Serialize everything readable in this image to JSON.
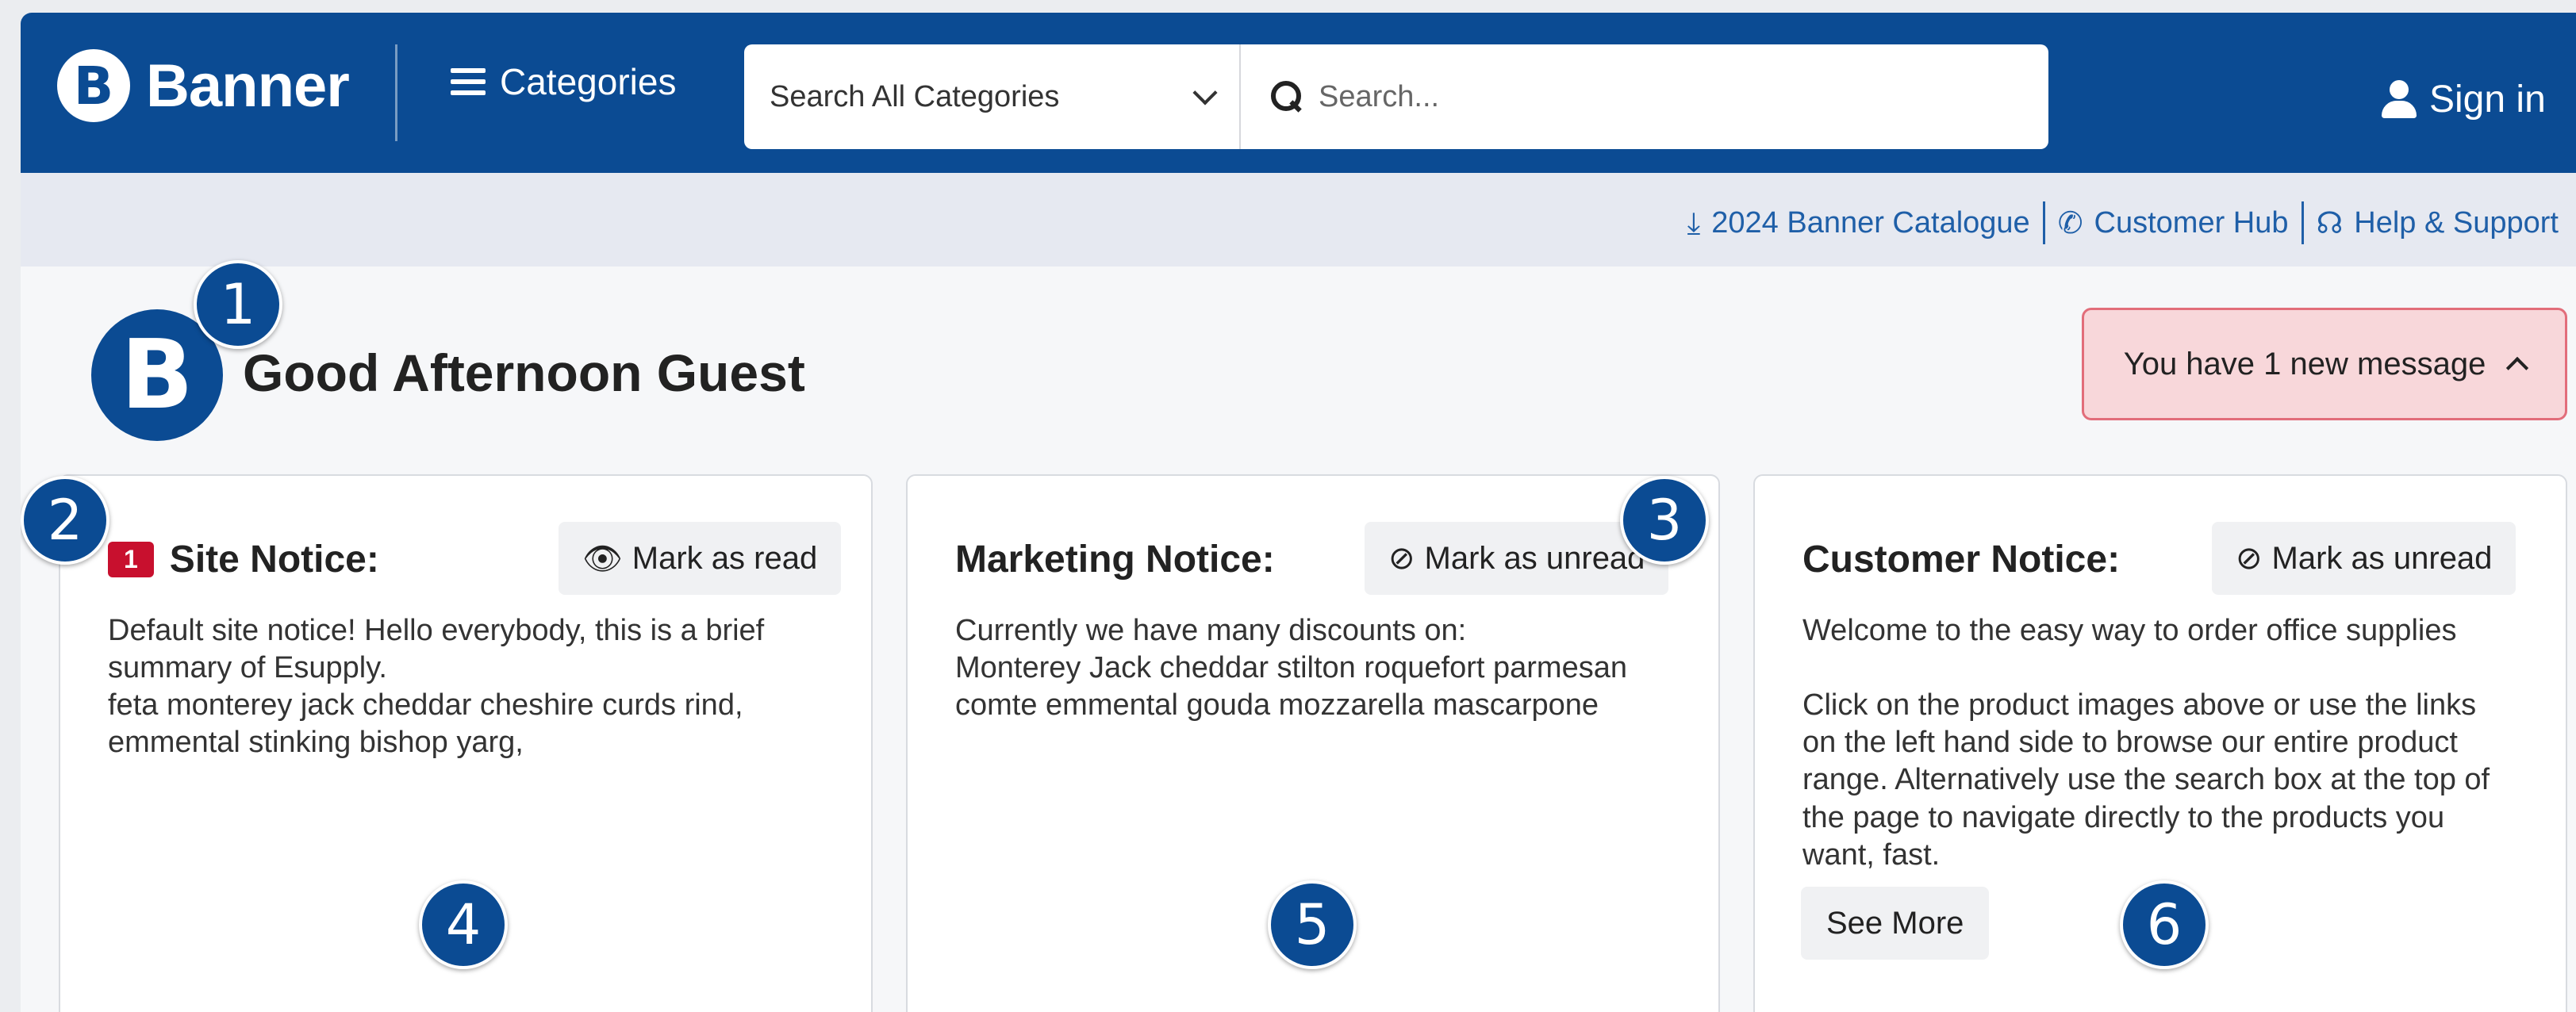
{
  "header": {
    "brand_letter": "B",
    "brand_name": "Banner",
    "categories_label": "Categories",
    "search_category": "Search All Categories",
    "search_placeholder": "Search...",
    "signin_label": "Sign in"
  },
  "quicklinks": [
    {
      "icon": "download-icon",
      "label": "2024 Banner Catalogue"
    },
    {
      "icon": "phone-icon",
      "label": "Customer Hub"
    },
    {
      "icon": "headset-icon",
      "label": "Help & Support"
    }
  ],
  "greeting": {
    "logo_letter": "B",
    "text": "Good Afternoon Guest",
    "message_alert": "You have 1 new message"
  },
  "cards": [
    {
      "badge": "1",
      "title": "Site Notice:",
      "button_label": "Mark as read",
      "button_icon": "eye-icon",
      "body": "Default site notice! Hello everybody, this is a brief\nsummary of Esupply.\nfeta monterey jack cheddar cheshire curds rind,\nemmental stinking bishop yarg,"
    },
    {
      "title": "Marketing Notice:",
      "button_label": "Mark as unread",
      "button_icon": "eye-slash-icon",
      "body": "Currently we have many discounts on:\nMonterey Jack cheddar stilton roquefort parmesan\ncomte emmental gouda mozzarella mascarpone"
    },
    {
      "title": "Customer Notice:",
      "button_label": "Mark as unread",
      "button_icon": "eye-slash-icon",
      "body": "Welcome to the easy way to order office supplies\n\nClick on the product images above or use the links\non the left hand side to browse our entire product\nrange. Alternatively use the search box at the top of\nthe page to navigate directly to the products you\nwant, fast.",
      "see_more_label": "See More"
    }
  ],
  "markers": [
    "1",
    "2",
    "3",
    "4",
    "5",
    "6"
  ],
  "colors": {
    "brand_blue": "#0b4b93",
    "alert_bg": "#f8d7da",
    "badge_red": "#c8102e",
    "link_blue": "#1f5fa8"
  }
}
